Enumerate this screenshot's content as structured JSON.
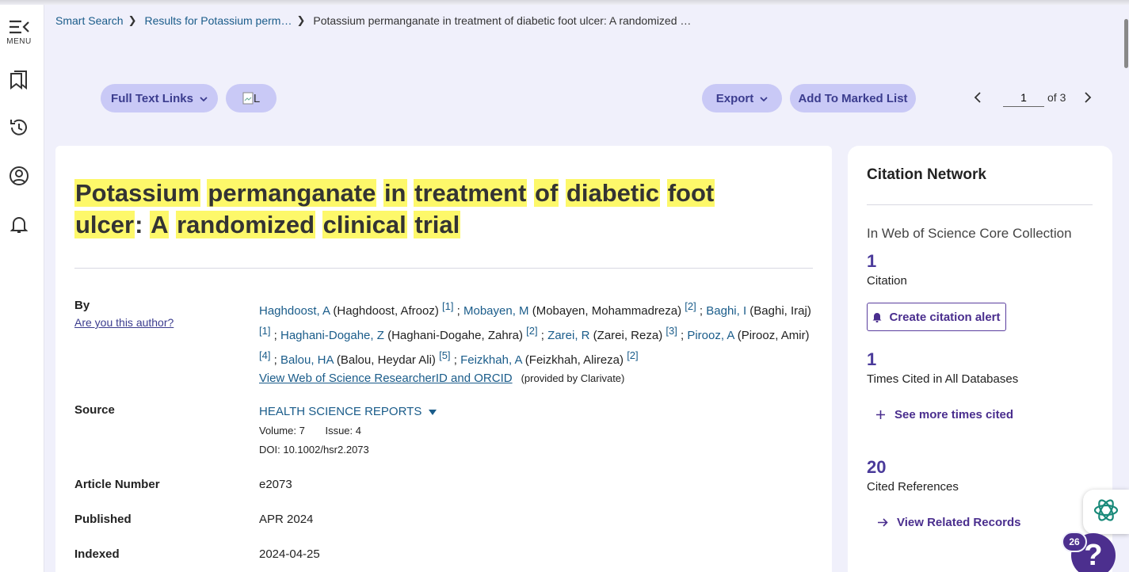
{
  "sidebar": {
    "menu_label": "MENU",
    "icons": [
      "menu-collapse-icon",
      "bookmark-icon",
      "history-icon",
      "profile-icon",
      "notification-bell-icon"
    ]
  },
  "breadcrumb": {
    "items": [
      "Smart Search",
      "Results for Potassium perm…"
    ],
    "current": "Potassium permanganate in treatment of diabetic foot ulcer: A randomized …"
  },
  "toolbar": {
    "full_text_links": "Full Text Links",
    "library_image_alt": "L",
    "export": "Export",
    "add_to_marked_list": "Add To Marked List",
    "page_value": "1",
    "page_of": "of 3"
  },
  "record": {
    "title_words": [
      "Potassium",
      "permanganate",
      "in",
      "treatment",
      "of",
      "diabetic",
      "foot",
      "ulcer",
      ":",
      "A",
      "randomized",
      "clinical",
      "trial"
    ],
    "by_label": "By",
    "are_you_author": "Are you this author?",
    "authors": [
      {
        "short": "Haghdoost, A",
        "full": "(Haghdoost, Afrooz)",
        "ref": "[1]"
      },
      {
        "short": "Mobayen, M",
        "full": "(Mobayen, Mohammadreza)",
        "ref": "[2]"
      },
      {
        "short": "Baghi, I",
        "full": "(Baghi, Iraj)",
        "ref": "[1]"
      },
      {
        "short": "Haghani-Dogahe, Z",
        "full": "(Haghani-Dogahe, Zahra)",
        "ref": "[2]"
      },
      {
        "short": "Zarei, R",
        "full": "(Zarei, Reza)",
        "ref": "[3]"
      },
      {
        "short": "Pirooz, A",
        "full": "(Pirooz, Amir)",
        "ref": "[4]"
      },
      {
        "short": "Balou, HA",
        "full": "(Balou, Heydar Ali)",
        "ref": "[5]"
      },
      {
        "short": "Feizkhah, A",
        "full": "(Feizkhah, Alireza)",
        "ref": "[2]"
      }
    ],
    "researcher_link": "View Web of Science ResearcherID and ORCID",
    "provided_by": "(provided by Clarivate)",
    "source_label": "Source",
    "source_value": "HEALTH SCIENCE REPORTS",
    "volume": "Volume: 7",
    "issue": "Issue: 4",
    "doi": "DOI: 10.1002/hsr2.2073",
    "article_number_label": "Article Number",
    "article_number": "e2073",
    "published_label": "Published",
    "published": "APR 2024",
    "indexed_label": "Indexed",
    "indexed": "2024-04-25"
  },
  "citation_network": {
    "title": "Citation Network",
    "collection": "In Web of Science Core Collection",
    "citations": "1",
    "citations_label": "Citation",
    "create_alert": "Create citation alert",
    "times_cited": "1",
    "times_cited_label": "Times Cited in All Databases",
    "see_more": "See more times cited",
    "cited_refs": "20",
    "cited_refs_label": "Cited References",
    "related": "View Related Records"
  },
  "help": {
    "badge": "26",
    "icon": "?"
  },
  "colors": {
    "highlight": "#fdf86a",
    "pill_bg": "#c9c9f6",
    "accent_purple": "#4a2e8e",
    "link_blue": "#1a5c8a"
  }
}
